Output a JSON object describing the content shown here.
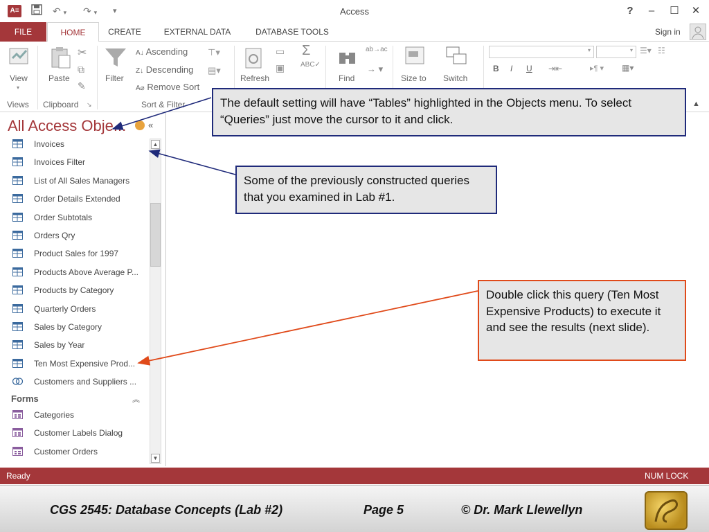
{
  "window": {
    "title": "Access",
    "help": "?",
    "minimize": "–",
    "maximize": "☐",
    "close": "✕"
  },
  "tabs": [
    "FILE",
    "HOME",
    "CREATE",
    "EXTERNAL DATA",
    "DATABASE TOOLS"
  ],
  "sign_in": "Sign in",
  "ribbon": {
    "view": "View",
    "paste": "Paste",
    "filter": "Filter",
    "ascending": "Ascending",
    "descending": "Descending",
    "remove_sort": "Remove Sort",
    "refresh": "Refresh",
    "find": "Find",
    "size_to": "Size to",
    "switch": "Switch",
    "groups": {
      "views": "Views",
      "clipboard": "Clipboard",
      "sort_filter": "Sort & Filter"
    }
  },
  "nav": {
    "title": "All Access Obje...",
    "collapse": "«",
    "queries": [
      "Invoices",
      "Invoices Filter",
      "List of All Sales Managers",
      "Order Details Extended",
      "Order Subtotals",
      "Orders Qry",
      "Product Sales for 1997",
      "Products Above Average P...",
      "Products by Category",
      "Quarterly Orders",
      "Sales by Category",
      "Sales by Year",
      "Ten Most Expensive Prod...",
      "Customers and Suppliers ..."
    ],
    "forms_header": "Forms",
    "forms": [
      "Categories",
      "Customer Labels Dialog",
      "Customer Orders"
    ]
  },
  "status": {
    "left": "Ready",
    "right": "NUM LOCK"
  },
  "callouts": {
    "c1": "The default setting will have “Tables” highlighted in the Objects menu.  To select “Queries” just move the cursor to it and click.",
    "c2": "Some of the previously constructed queries that you examined in Lab #1.",
    "c3": "Double click this query (Ten Most Expensive Products) to execute it and see the results (next slide)."
  },
  "footer": {
    "course": "CGS 2545: Database Concepts  (Lab #2)",
    "page": "Page 5",
    "author": "© Dr. Mark Llewellyn"
  },
  "colors": {
    "accent": "#a4373a",
    "callout_blue_border": "#1f2a7a",
    "callout_orange_border": "#e04a1a"
  }
}
